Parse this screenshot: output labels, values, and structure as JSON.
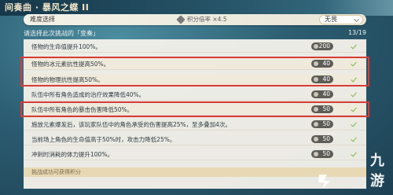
{
  "header": {
    "title": "间奏曲 · 暴风之蝶 II"
  },
  "difficulty": {
    "label": "难度选择",
    "multiplier": "积分倍率 ×4.5",
    "selected": "无畏"
  },
  "subtitle": "请选择此次挑战的「变奏」",
  "count": "13/19",
  "rows": [
    {
      "text": "怪物的生命值提升100%。",
      "points": "200",
      "checked": true
    },
    {
      "text": "怪物的冰元素抗性提高50%。",
      "points": "40",
      "checked": true
    },
    {
      "text": "怪物的物理抗性提高50%。",
      "points": "40",
      "checked": true
    },
    {
      "text": "队伍中所有角色造成的治疗效果降低40%。",
      "points": "40",
      "checked": true
    },
    {
      "text": "队伍中所有角色的暴击伤害降低50%。",
      "points": "50",
      "checked": true
    },
    {
      "text": "施放元素爆发后，该玩家队伍中的角色承受的伤害提高25%，至多叠加4次。",
      "points": "50",
      "checked": true
    },
    {
      "text": "当前场上角色的生命值高于50%时，攻击力降低25%。",
      "points": "50",
      "checked": true
    },
    {
      "text": "冲刺时消耗的体力提升100%。",
      "points": "50",
      "checked": true
    }
  ],
  "footer": "挑战成功可获得积分",
  "watermark": "九游",
  "colors": {
    "highlight_box": "#d93b35",
    "check": "#7dbb3c"
  },
  "icons": {
    "multiplier": "diamond-icon",
    "points": "coin-icon",
    "checked": "checkmark-icon"
  }
}
